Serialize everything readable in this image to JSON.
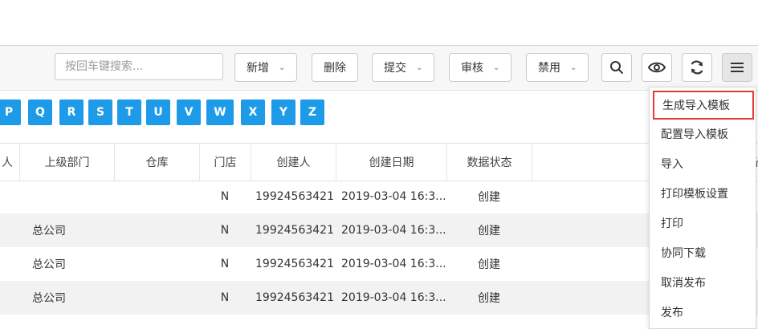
{
  "toolbar": {
    "search_placeholder": "按回车键搜索...",
    "buttons": {
      "add": "新增",
      "delete": "删除",
      "submit": "提交",
      "review": "审核",
      "disable": "禁用"
    }
  },
  "letters": [
    "P",
    "Q",
    "R",
    "S",
    "T",
    "U",
    "V",
    "W",
    "X",
    "Y",
    "Z"
  ],
  "table": {
    "headers": {
      "partial": "人",
      "parent_dept": "上级部门",
      "warehouse": "仓库",
      "store": "门店",
      "creator": "创建人",
      "created_date": "创建日期",
      "data_status": "数据状态",
      "remark": "备"
    },
    "rows": [
      {
        "parent_dept": "",
        "store": "N",
        "creator": "19924563421",
        "created_date": "2019-03-04 16:3...",
        "status": "创建"
      },
      {
        "parent_dept": "总公司",
        "store": "N",
        "creator": "19924563421",
        "created_date": "2019-03-04 16:3...",
        "status": "创建"
      },
      {
        "parent_dept": "总公司",
        "store": "N",
        "creator": "19924563421",
        "created_date": "2019-03-04 16:3...",
        "status": "创建"
      },
      {
        "parent_dept": "总公司",
        "store": "N",
        "creator": "19924563421",
        "created_date": "2019-03-04 16:3...",
        "status": "创建"
      }
    ]
  },
  "menu": {
    "items": [
      {
        "label": "生成导入模板",
        "highlighted": true
      },
      {
        "label": "配置导入模板"
      },
      {
        "label": "导入"
      },
      {
        "label": "打印模板设置"
      },
      {
        "label": "打印"
      },
      {
        "label": "协同下载"
      },
      {
        "label": "取消发布"
      },
      {
        "label": "发布"
      }
    ]
  },
  "colors": {
    "letter_bg": "#1e9be8",
    "highlight_border": "#e53935",
    "row_alt": "#f2f2f2"
  }
}
